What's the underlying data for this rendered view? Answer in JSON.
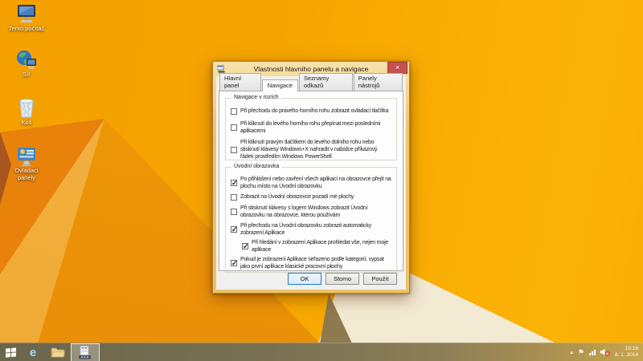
{
  "desktop": {
    "icons": [
      {
        "name": "this-pc",
        "label": "Tento počítač"
      },
      {
        "name": "network",
        "label": "Síť"
      },
      {
        "name": "recycle-bin",
        "label": "Koš"
      },
      {
        "name": "control-panel",
        "label": "Ovládací panely"
      }
    ]
  },
  "dialog": {
    "title": "Vlastnosti hlavního panelu a navigace",
    "close_label": "×",
    "tabs": [
      {
        "label": "Hlavní panel",
        "selected": false
      },
      {
        "label": "Navigace",
        "selected": true
      },
      {
        "label": "Seznamy odkazů",
        "selected": false
      },
      {
        "label": "Panely nástrojů",
        "selected": false
      }
    ],
    "groups": [
      {
        "title": "Navigace v rozích",
        "items": [
          {
            "label": "Při přechodu do pravého horního rohu zobrazit ovládací tlačítka",
            "checked": false
          },
          {
            "label": "Při kliknutí do levého horního rohu přepínat mezi posledními aplikacemi",
            "checked": false
          },
          {
            "label": "Při kliknutí pravým tlačítkem do levého dolního rohu nebo stisknutí klávesy Windows+X nahradit v nabídce příkazový řádek prostředím Windows PowerShell",
            "checked": false
          }
        ]
      },
      {
        "title": "Úvodní obrazovka",
        "items": [
          {
            "label": "Po přihlášení nebo zavření všech aplikací na obrazovce přejít na plochu místo na Úvodní obrazovku",
            "checked": true
          },
          {
            "label": "Zobrazit na Úvodní obrazovce pozadí mé plochy",
            "checked": false
          },
          {
            "label": "Při stisknutí klávesy s logem Windows zobrazit Úvodní obrazovku na obrazovce, kterou používám",
            "checked": false
          },
          {
            "label": "Při přechodu na Úvodní obrazovku zobrazit automaticky zobrazení Aplikace",
            "checked": true
          },
          {
            "label": "Při hledání v zobrazení Aplikace prohledat vše, nejen moje aplikace",
            "checked": true,
            "indent": true
          },
          {
            "label": "Pokud je zobrazení Aplikace seřazeno podle kategorií, vypsat jako první aplikace klasické pracovní plochy",
            "checked": true
          }
        ]
      }
    ],
    "buttons": [
      {
        "label": "OK"
      },
      {
        "label": "Storno"
      },
      {
        "label": "Použít"
      }
    ]
  },
  "taskbar": {
    "buttons": [
      {
        "icon": "start"
      },
      {
        "icon": "internet-explorer"
      },
      {
        "icon": "file-explorer"
      },
      {
        "icon": "taskbar-properties",
        "active": true
      }
    ],
    "tray_icons": [
      "hidden-icons-caret",
      "action-center-flag",
      "network-signal",
      "volume-muted"
    ],
    "clock": {
      "time": "19:16",
      "date": "8. 1. 2014"
    }
  },
  "colors": {
    "wallpaper_base": "#f6a500",
    "wallpaper_dark": "#e8820a",
    "wallpaper_cream": "#f3ead3",
    "dialog_frame": "#f0c468",
    "close_button": "#c75050",
    "taskbar": "#7a7253",
    "focus_border": "#2a76c9"
  }
}
